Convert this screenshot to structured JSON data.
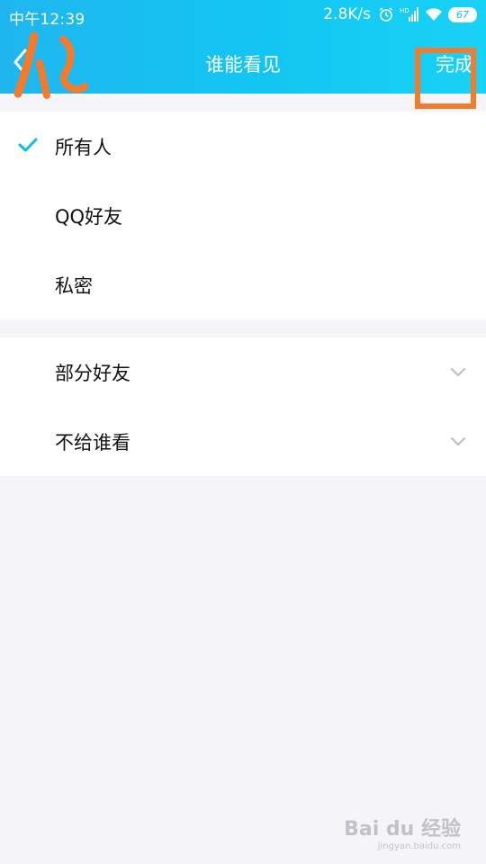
{
  "status_bar": {
    "time": "中午12:39",
    "net_speed": "2.8K/s",
    "battery": "67",
    "icons": [
      "alarm-icon",
      "signal-icon",
      "wifi-icon",
      "battery-icon"
    ]
  },
  "nav": {
    "title": "谁能看见",
    "done_label": "完成",
    "back_icon": "chevron-left-icon"
  },
  "visibility_options": [
    {
      "label": "所有人",
      "selected": true
    },
    {
      "label": "QQ好友",
      "selected": false
    },
    {
      "label": "私密",
      "selected": false
    }
  ],
  "group_options": [
    {
      "label": "部分好友",
      "icon": "chevron-down-icon"
    },
    {
      "label": "不给谁看",
      "icon": "chevron-down-icon"
    }
  ],
  "colors": {
    "header_gradient_start": "#1fb6f0",
    "header_gradient_end": "#18d2f5",
    "check": "#12b7f5",
    "annotation": "#f47a2c",
    "background": "#f5f5f7"
  },
  "watermark": {
    "brand": "Bai du 经验",
    "url": "jingyan.baidu.com"
  }
}
